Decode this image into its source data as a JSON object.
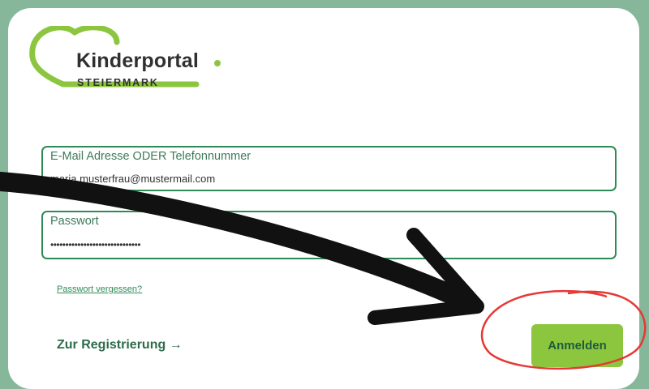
{
  "brand": {
    "name": "Kinderportal",
    "subtitle": "STEIERMARK",
    "logo_icon": "heart-outline-icon",
    "accent_color": "#8cc63f",
    "primary_color": "#2e8b57"
  },
  "login": {
    "email_label": "E-Mail Adresse ODER Telefonnummer",
    "email_value": "maria.musterfrau@mustermail.com",
    "password_label": "Passwort",
    "password_value": "••••••••••••••••••••••••••••••",
    "forgot_password": "Passwort vergessen?",
    "register_link": "Zur Registrierung →",
    "submit_label": "Anmelden"
  },
  "annotations": {
    "arrow_icon": "curved-arrow-icon",
    "highlight_icon": "red-circle-highlight-icon",
    "arrow_color": "#111111",
    "highlight_color": "#e53935"
  }
}
